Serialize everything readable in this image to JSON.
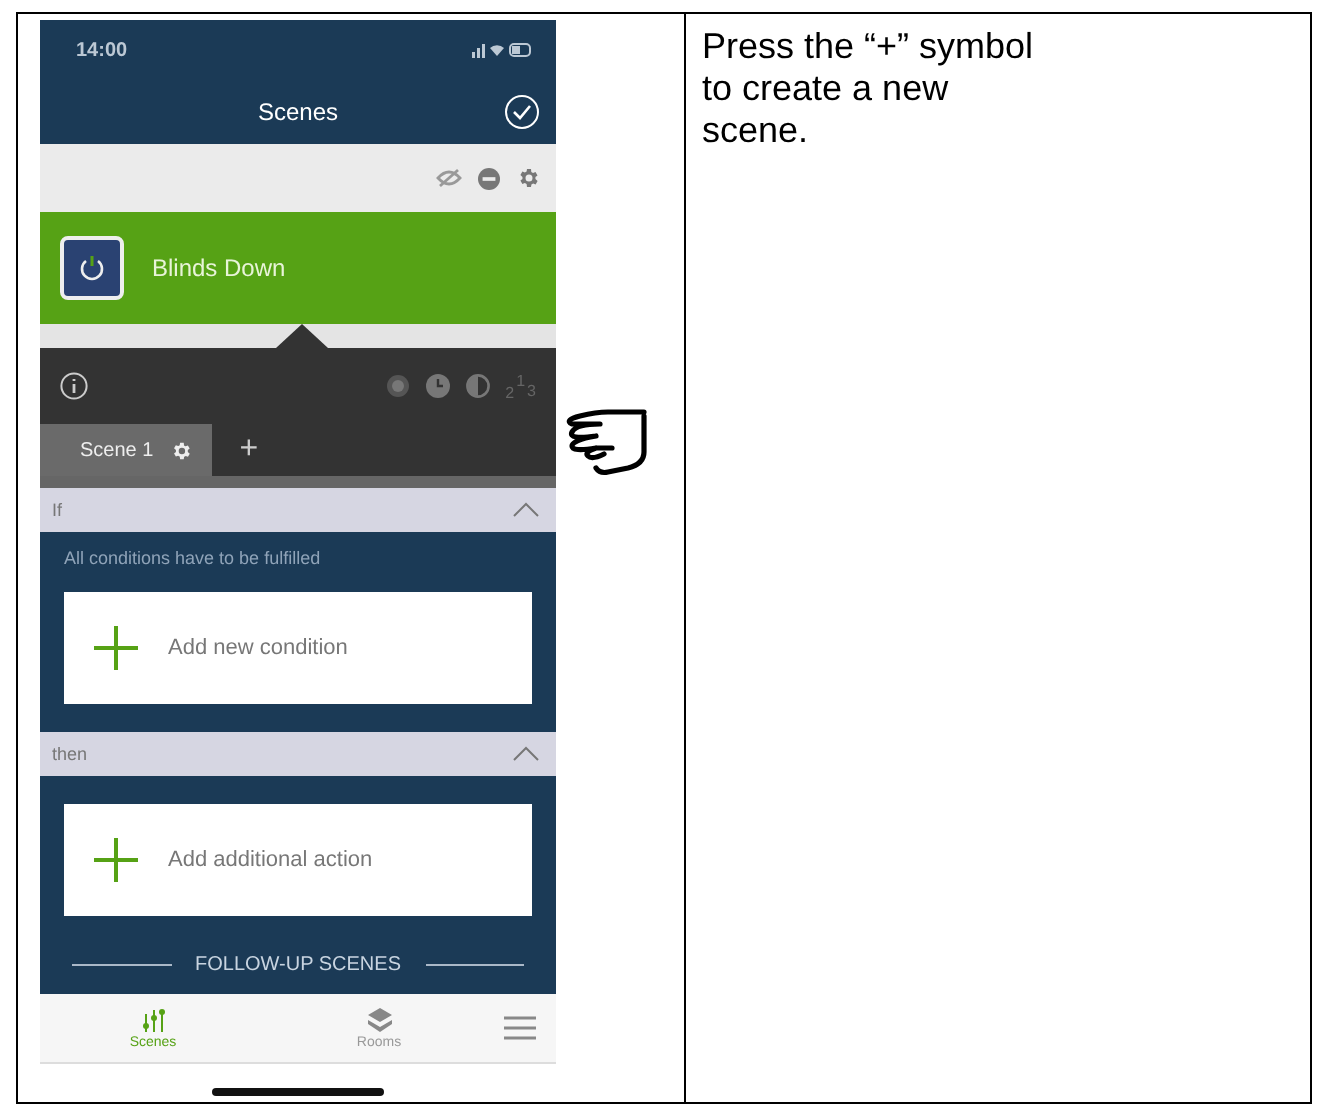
{
  "status_bar": {
    "time": "14:00"
  },
  "header": {
    "title": "Scenes"
  },
  "scene": {
    "name": "Blinds Down"
  },
  "toolbar": {
    "sequence": [
      "2",
      "1",
      "3"
    ]
  },
  "tabs": [
    {
      "label": "Scene 1",
      "selected": true
    }
  ],
  "add_tab": "+",
  "sections": [
    {
      "title": "If",
      "expanded": true,
      "note": "All conditions have to be fulfilled",
      "action": "Add new condition"
    },
    {
      "title": "then",
      "expanded": true,
      "action": "Add additional action"
    }
  ],
  "follow_up": "FOLLOW-UP SCENES",
  "nav": [
    {
      "label": "Scenes",
      "selected": true
    },
    {
      "label": "Rooms",
      "selected": false
    }
  ],
  "instruction": "Press the “+” symbol to create a new scene."
}
